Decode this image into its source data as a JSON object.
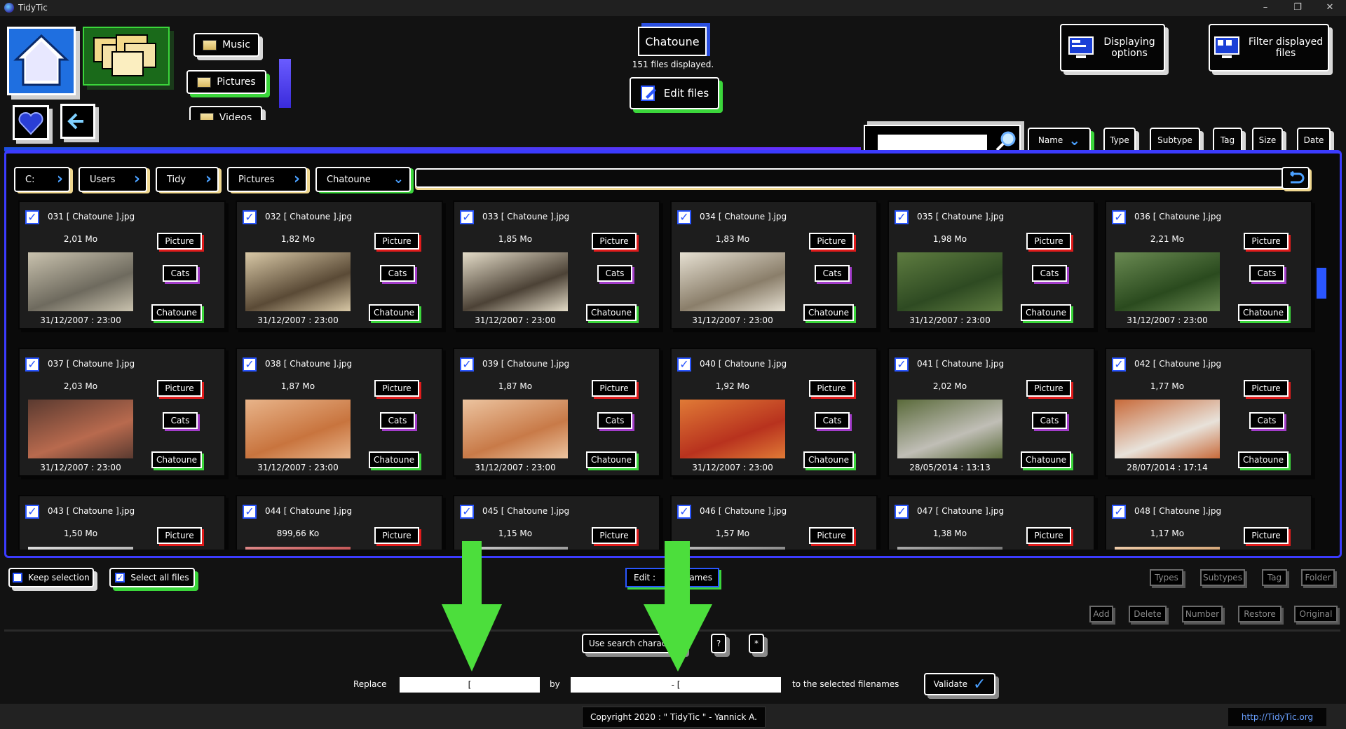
{
  "app": {
    "title": "TidyTic"
  },
  "nav": {
    "home": "home",
    "categories": [
      {
        "label": "Music"
      },
      {
        "label": "Pictures"
      },
      {
        "label": "Videos"
      }
    ]
  },
  "folder": {
    "name": "Chatoune",
    "count": "151 files displayed.",
    "edit": "Edit files"
  },
  "options": {
    "display": "Displaying options",
    "filter": "Filter displayed files"
  },
  "sort": {
    "name": "Name",
    "type": "Type",
    "subtype": "Subtype",
    "tag": "Tag",
    "size": "Size",
    "date": "Date",
    "search_value": ""
  },
  "path": [
    {
      "label": "C:"
    },
    {
      "label": "Users"
    },
    {
      "label": "Tidy"
    },
    {
      "label": "Pictures"
    },
    {
      "label": "Chatoune"
    }
  ],
  "cards": [
    {
      "name": "031 [ Chatoune ].jpg",
      "size": "2,01 Mo",
      "date": "31/12/2007 : 23:00",
      "type": "Picture",
      "tag": "Cats",
      "folder": "Chatoune",
      "c1": "#6e6a5e",
      "c2": "#c9c2ae"
    },
    {
      "name": "032 [ Chatoune ].jpg",
      "size": "1,82 Mo",
      "date": "31/12/2007 : 23:00",
      "type": "Picture",
      "tag": "Cats",
      "folder": "Chatoune",
      "c1": "#5a4a36",
      "c2": "#d8c8a6"
    },
    {
      "name": "033 [ Chatoune ].jpg",
      "size": "1,85 Mo",
      "date": "31/12/2007 : 23:00",
      "type": "Picture",
      "tag": "Cats",
      "folder": "Chatoune",
      "c1": "#4c4236",
      "c2": "#e4dcc8"
    },
    {
      "name": "034 [ Chatoune ].jpg",
      "size": "1,83 Mo",
      "date": "31/12/2007 : 23:00",
      "type": "Picture",
      "tag": "Cats",
      "folder": "Chatoune",
      "c1": "#8a7e6a",
      "c2": "#e6e0d2"
    },
    {
      "name": "035 [ Chatoune ].jpg",
      "size": "1,98 Mo",
      "date": "31/12/2007 : 23:00",
      "type": "Picture",
      "tag": "Cats",
      "folder": "Chatoune",
      "c1": "#2e4a22",
      "c2": "#5e7c40"
    },
    {
      "name": "036 [ Chatoune ].jpg",
      "size": "2,21 Mo",
      "date": "31/12/2007 : 23:00",
      "type": "Picture",
      "tag": "Cats",
      "folder": "Chatoune",
      "c1": "#2a4a1e",
      "c2": "#6a8a52"
    },
    {
      "name": "037 [ Chatoune ].jpg",
      "size": "2,03 Mo",
      "date": "31/12/2007 : 23:00",
      "type": "Picture",
      "tag": "Cats",
      "folder": "Chatoune",
      "c1": "#b86a4e",
      "c2": "#5a3a30"
    },
    {
      "name": "038 [ Chatoune ].jpg",
      "size": "1,87 Mo",
      "date": "31/12/2007 : 23:00",
      "type": "Picture",
      "tag": "Cats",
      "folder": "Chatoune",
      "c1": "#c8743e",
      "c2": "#e8b48a"
    },
    {
      "name": "039 [ Chatoune ].jpg",
      "size": "1,87 Mo",
      "date": "31/12/2007 : 23:00",
      "type": "Picture",
      "tag": "Cats",
      "folder": "Chatoune",
      "c1": "#c87a48",
      "c2": "#ecc4a0"
    },
    {
      "name": "040 [ Chatoune ].jpg",
      "size": "1,92 Mo",
      "date": "31/12/2007 : 23:00",
      "type": "Picture",
      "tag": "Cats",
      "folder": "Chatoune",
      "c1": "#b8321e",
      "c2": "#e07a36"
    },
    {
      "name": "041 [ Chatoune ].jpg",
      "size": "2,02 Mo",
      "date": "28/05/2014 : 13:13",
      "type": "Picture",
      "tag": "Cats",
      "folder": "Chatoune",
      "c1": "#c0beb6",
      "c2": "#5a6a3a"
    },
    {
      "name": "042 [ Chatoune ].jpg",
      "size": "1,77 Mo",
      "date": "28/07/2014 : 17:14",
      "type": "Picture",
      "tag": "Cats",
      "folder": "Chatoune",
      "c1": "#e8e2da",
      "c2": "#c86a3a"
    },
    {
      "name": "043 [ Chatoune ].jpg",
      "size": "1,50 Mo",
      "date": "",
      "type": "Picture",
      "tag": "",
      "folder": "",
      "c1": "#aaa",
      "c2": "#ddd"
    },
    {
      "name": "044 [ Chatoune ].jpg",
      "size": "899,66 Ko",
      "date": "",
      "type": "Picture",
      "tag": "",
      "folder": "",
      "c1": "#b44",
      "c2": "#d88"
    },
    {
      "name": "045 [ Chatoune ].jpg",
      "size": "1,15 Mo",
      "date": "",
      "type": "Picture",
      "tag": "",
      "folder": "",
      "c1": "#888",
      "c2": "#ccc"
    },
    {
      "name": "046 [ Chatoune ].jpg",
      "size": "1,57 Mo",
      "date": "",
      "type": "Picture",
      "tag": "",
      "folder": "",
      "c1": "#777",
      "c2": "#bbb"
    },
    {
      "name": "047 [ Chatoune ].jpg",
      "size": "1,38 Mo",
      "date": "",
      "type": "Picture",
      "tag": "",
      "folder": "",
      "c1": "#666",
      "c2": "#aaa"
    },
    {
      "name": "048 [ Chatoune ].jpg",
      "size": "1,17 Mo",
      "date": "",
      "type": "Picture",
      "tag": "",
      "folder": "",
      "c1": "#c96",
      "c2": "#eca"
    }
  ],
  "bottom": {
    "keep": "Keep selection",
    "selectall": "Select all files",
    "edit_mode": "Edit :",
    "edit_mode_tail": "ames",
    "right1": [
      "Types",
      "Subtypes",
      "Tag",
      "Folder"
    ],
    "right2": [
      "Add",
      "Delete",
      "Number",
      "Restore",
      "Original"
    ],
    "usesearch": "Use search charact",
    "help": "?",
    "star": "*",
    "replace": "Replace",
    "replace_value": "[",
    "by": "by",
    "by_value": "- [",
    "to": "to the selected filenames",
    "validate": "Validate",
    "copyright": "Copyright 2020 : \" TidyTic \" - Yannick A.",
    "link": "http://TidyTic.org"
  },
  "colors": {
    "accent_blue": "#3b3bff",
    "green": "#3bd63b",
    "red": "#e01b1b",
    "purple": "#a23cc9",
    "arrow": "#4cde3c"
  }
}
